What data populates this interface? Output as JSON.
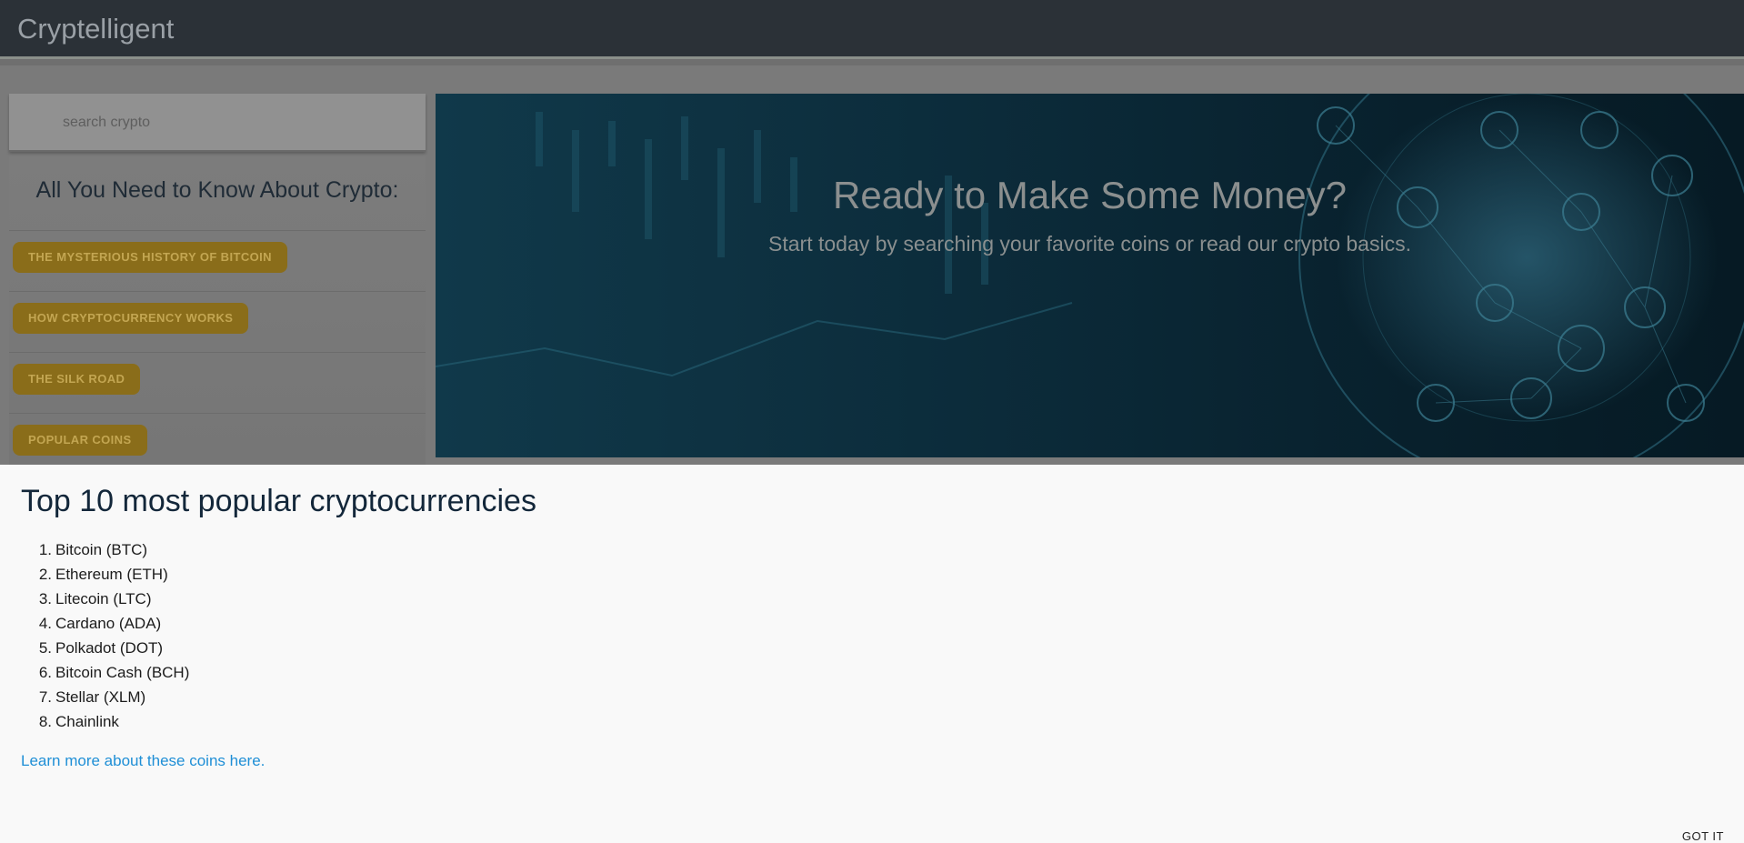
{
  "navbar": {
    "brand": "Cryptelligent"
  },
  "sidebar": {
    "search_placeholder": "search crypto",
    "heading": "All You Need to Know About Crypto:",
    "links": [
      "THE MYSTERIOUS HISTORY OF BITCOIN",
      "HOW CRYPTOCURRENCY WORKS",
      "THE SILK ROAD",
      "POPULAR COINS"
    ]
  },
  "hero": {
    "title": "Ready to Make Some Money?",
    "subtitle": "Start today by searching your favorite coins or read our crypto basics."
  },
  "main": {
    "title": "Top 10 most popular cryptocurrencies",
    "coins": [
      "Bitcoin (BTC)",
      "Ethereum (ETH)",
      "Litecoin (LTC)",
      "Cardano (ADA)",
      "Polkadot (DOT)",
      "Bitcoin Cash (BCH)",
      "Stellar (XLM)",
      "Chainlink"
    ],
    "learn_more": "Learn more about these coins here."
  },
  "cookie_banner": {
    "got_it": "GOT IT"
  },
  "colors": {
    "navbar": "#2b3137",
    "pill_bg": "#8a6d1a",
    "pill_text": "#c3a652",
    "link": "#1f8fd6",
    "title": "#13273a"
  },
  "icons": [
    "globe-network-illustration",
    "candlestick-chart-illustration"
  ]
}
